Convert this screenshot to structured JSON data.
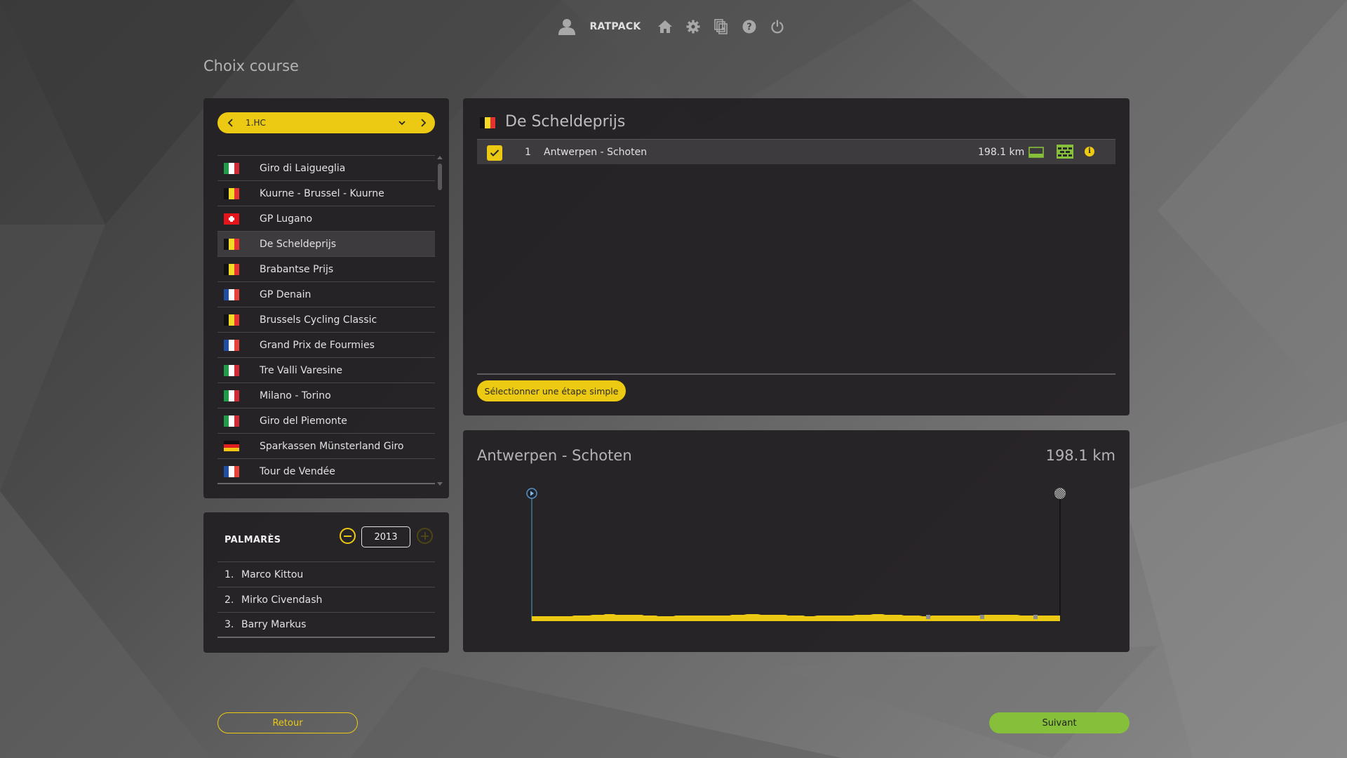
{
  "topbar": {
    "username": "RATPACK",
    "icons": [
      "user-icon",
      "home-icon",
      "gear-icon",
      "cards-icon",
      "help-icon",
      "power-icon"
    ]
  },
  "page": {
    "title": "Choix course"
  },
  "category_select": {
    "value": "1.HC"
  },
  "races": [
    {
      "name": "Giro di Laigueglia",
      "flag": "it"
    },
    {
      "name": "Kuurne - Brussel - Kuurne",
      "flag": "be"
    },
    {
      "name": "GP Lugano",
      "flag": "ch"
    },
    {
      "name": "De Scheldeprijs",
      "flag": "be",
      "selected": true
    },
    {
      "name": "Brabantse Prijs",
      "flag": "be"
    },
    {
      "name": "GP Denain",
      "flag": "fr"
    },
    {
      "name": "Brussels Cycling Classic",
      "flag": "be"
    },
    {
      "name": "Grand Prix de Fourmies",
      "flag": "fr"
    },
    {
      "name": "Tre Valli Varesine",
      "flag": "it"
    },
    {
      "name": "Milano - Torino",
      "flag": "it"
    },
    {
      "name": "Giro del Piemonte",
      "flag": "it"
    },
    {
      "name": "Sparkassen Münsterland Giro",
      "flag": "de"
    },
    {
      "name": "Tour de Vendée",
      "flag": "fr"
    }
  ],
  "palmares": {
    "title": "PALMARÈS",
    "year": "2013",
    "entries": [
      {
        "rank": "1.",
        "name": "Marco Kittou"
      },
      {
        "rank": "2.",
        "name": "Mirko Civendash"
      },
      {
        "rank": "3.",
        "name": "Barry Markus"
      }
    ]
  },
  "race_detail": {
    "title": "De Scheldeprijs",
    "flag": "be",
    "stages": [
      {
        "checked": true,
        "number": "1",
        "name": "Antwerpen - Schoten",
        "distance": "198.1 km"
      }
    ],
    "select_single_stage_label": "Sélectionner une étape simple"
  },
  "profile": {
    "title": "Antwerpen - Schoten",
    "distance": "198.1 km"
  },
  "footer": {
    "back_label": "Retour",
    "next_label": "Suivant"
  },
  "colors": {
    "accent_yellow": "#ecc913",
    "accent_green": "#86bf39",
    "panel_bg": "#252225"
  }
}
